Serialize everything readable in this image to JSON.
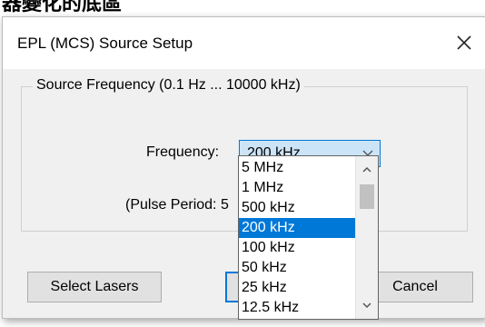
{
  "background_text": "器變化的底區",
  "dialog": {
    "title": "EPL (MCS) Source Setup",
    "close_icon": "close-icon",
    "group_label": "Source Frequency (0.1 Hz ... 10000 kHz)",
    "frequency_label": "Frequency:",
    "frequency_value": "200 kHz",
    "pulse_period_label": "(Pulse Period: 5"
  },
  "buttons": {
    "select_lasers": "Select Lasers",
    "ok": "",
    "cancel": "Cancel"
  },
  "dropdown": {
    "items": [
      "5 MHz",
      "1 MHz",
      "500 kHz",
      "200 kHz",
      "100 kHz",
      "50 kHz",
      "25 kHz",
      "12.5 kHz"
    ],
    "selected": "200 kHz"
  },
  "colors": {
    "accent": "#0078d7",
    "combo_bg": "#cce4f7",
    "dialog_bg": "#f0f0f0"
  }
}
